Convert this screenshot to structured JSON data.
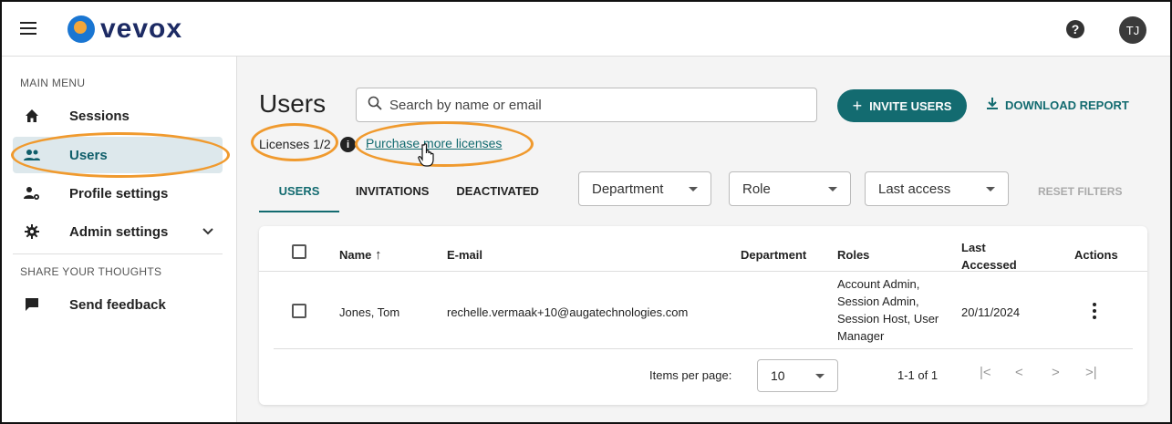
{
  "app": {
    "logo_text": "vevox",
    "avatar_initials": "TJ",
    "help_symbol": "?"
  },
  "sidebar": {
    "main_menu_heading": "MAIN MENU",
    "items": [
      {
        "label": "Sessions",
        "icon": "home-icon"
      },
      {
        "label": "Users",
        "icon": "users-icon",
        "active": true
      },
      {
        "label": "Profile settings",
        "icon": "profile-settings-icon"
      },
      {
        "label": "Admin settings",
        "icon": "gear-icon"
      }
    ],
    "share_heading": "SHARE YOUR THOUGHTS",
    "feedback_label": "Send feedback"
  },
  "main": {
    "title": "Users",
    "search_placeholder": "Search by name or email",
    "invite_label": "INVITE USERS",
    "download_label": "DOWNLOAD REPORT",
    "licenses": "Licenses 1/2",
    "purchase_link": "Purchase more licenses",
    "tabs": [
      "USERS",
      "INVITATIONS",
      "DEACTIVATED"
    ],
    "filters": {
      "department": "Department",
      "role": "Role",
      "last_access": "Last access"
    },
    "reset_filters": "RESET FILTERS"
  },
  "table": {
    "headers": {
      "name": "Name",
      "sort_arrow": "↑",
      "email": "E-mail",
      "department": "Department",
      "roles": "Roles",
      "last_accessed_1": "Last",
      "last_accessed_2": "Accessed",
      "actions": "Actions"
    },
    "rows": [
      {
        "name": "Jones, Tom",
        "email": "rechelle.vermaak+10@augatechnologies.com",
        "department": "",
        "roles_lines": [
          "Account Admin,",
          "Session Admin,",
          "Session Host, User",
          "Manager"
        ],
        "last_accessed": "20/11/2024"
      }
    ]
  },
  "pagination": {
    "items_per_page_label": "Items per page:",
    "items_per_page": "10",
    "range": "1-1 of 1",
    "first": "|<",
    "prev": "<",
    "next": ">",
    "last": ">|"
  },
  "colors": {
    "accent": "#136b70",
    "highlight": "#f09a2e",
    "active_bg": "#dde8ec"
  }
}
